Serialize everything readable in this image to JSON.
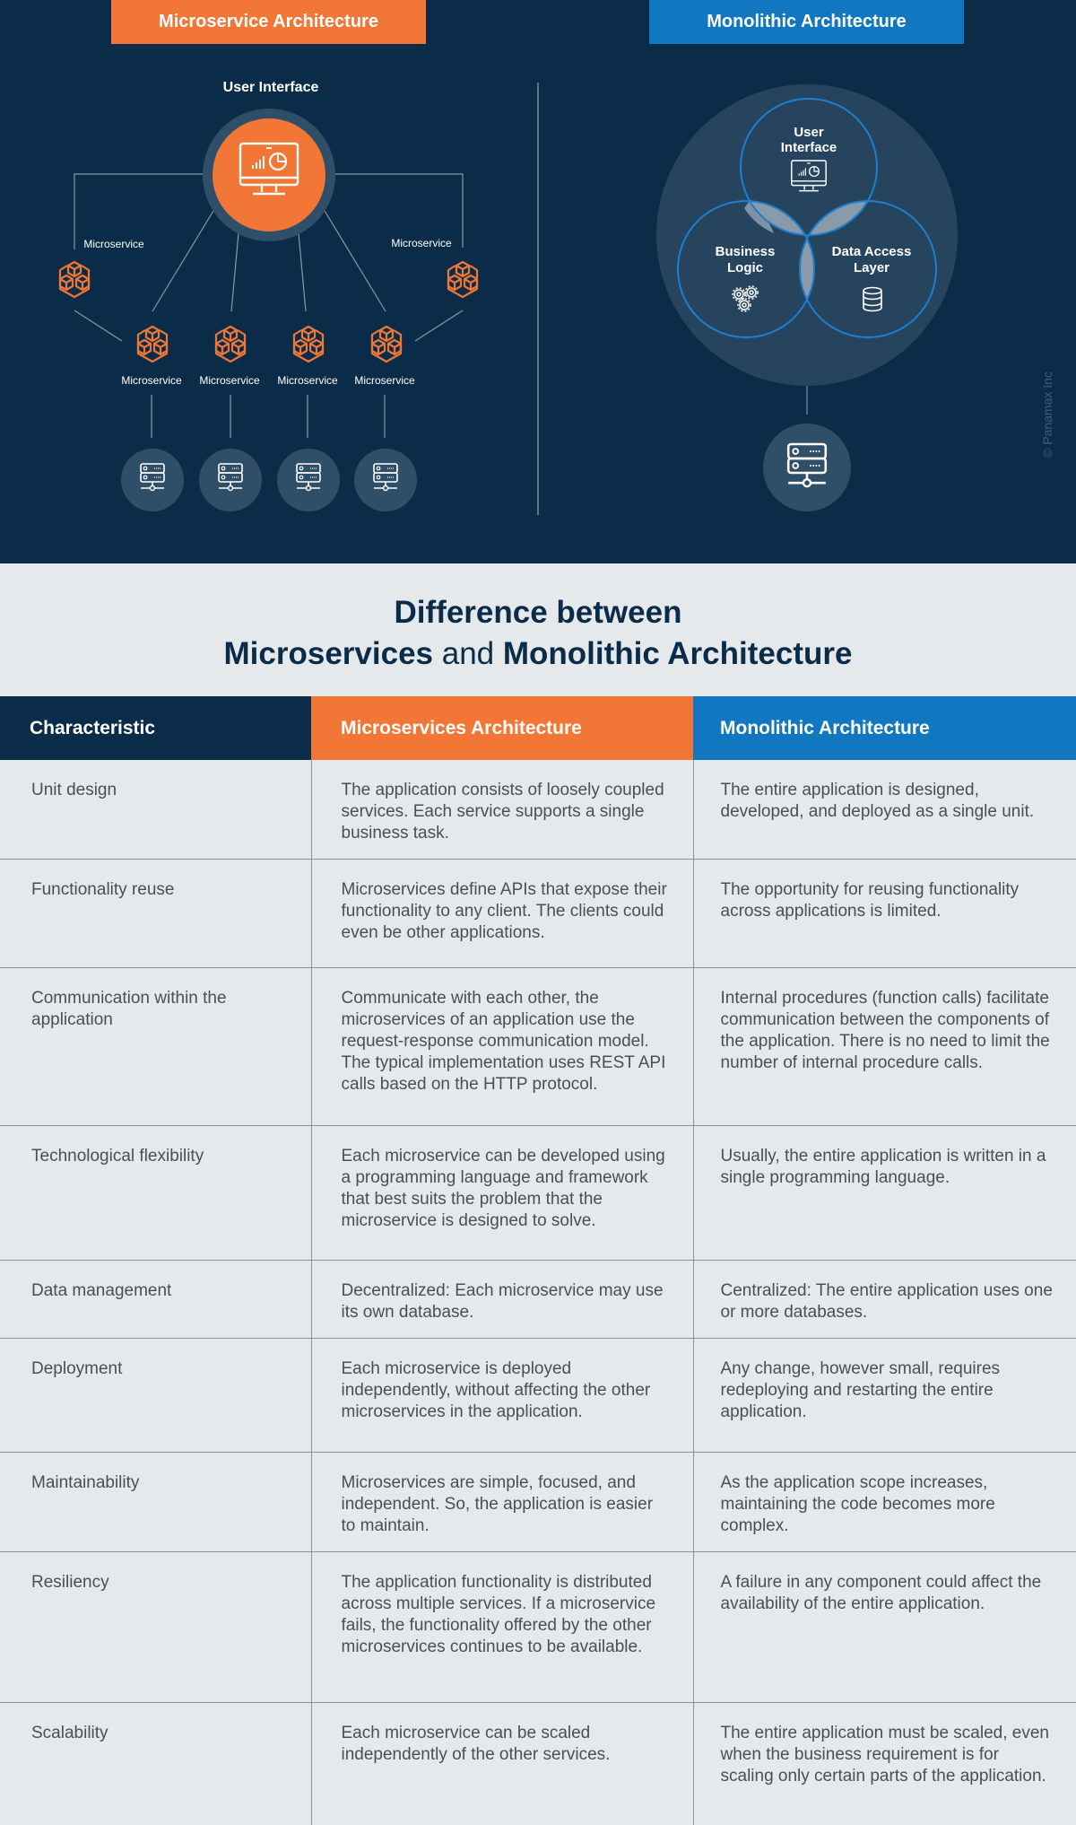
{
  "diagram": {
    "microservice_tag": "Microservice Architecture",
    "monolithic_tag": "Monolithic Architecture",
    "user_interface_label": "User Interface",
    "microservice_labels": [
      "Microservice",
      "Microservice",
      "Microservice",
      "Microservice",
      "Microservice",
      "Microservice"
    ],
    "venn": {
      "top": [
        "User",
        "Interface"
      ],
      "left": [
        "Business",
        "Logic"
      ],
      "right": [
        "Data Access",
        "Layer"
      ]
    },
    "icons": {
      "ui": "monitor-chart-icon",
      "microservice": "cubes-icon",
      "database_server": "server-icon",
      "business_logic": "gears-icon",
      "data_access": "database-icon"
    },
    "copyright": "© Panamax Inc",
    "colors": {
      "navy": "#0a2c48",
      "orange": "#f27636",
      "blue": "#1177c0",
      "light_bg": "#e6e9ec"
    }
  },
  "title": {
    "line1": "Difference between",
    "line2_a": "Microservices",
    "line2_and": " and ",
    "line2_b": "Monolithic Architecture"
  },
  "table": {
    "headers": [
      "Characteristic",
      "Microservices Architecture",
      "Monolithic Architecture"
    ],
    "rows": [
      [
        "Unit design",
        "The application consists of loosely coupled services. Each service supports a single business task.",
        "The entire application is designed, developed, and deployed as a single unit."
      ],
      [
        "Functionality reuse",
        "Microservices define APIs that expose their functionality to any client. The clients could even be other applications.",
        "The opportunity for reusing functionality across applications is limited."
      ],
      [
        "Communication within the application",
        "Communicate with each other, the microservices of an application use the request-response communication model. The typical implementation uses REST API calls based on the HTTP protocol.",
        "Internal procedures (function calls) facilitate communication between the components of the application. There is no need to limit the number of internal procedure calls."
      ],
      [
        "Technological flexibility",
        "Each microservice can be developed using a programming language and framework that best suits the problem that the microservice is designed to solve.",
        "Usually, the entire application is written in a single programming language."
      ],
      [
        "Data management",
        "Decentralized: Each microservice may use its own database.",
        "Centralized: The entire application uses one or more databases."
      ],
      [
        "Deployment",
        "Each microservice is deployed independently, without affecting the other microservices in the application.",
        "Any change, however small, requires redeploying and restarting the entire application."
      ],
      [
        "Maintainability",
        "Microservices are simple, focused, and independent. So, the application is easier to maintain.",
        "As the application scope increases, maintaining the code becomes more complex."
      ],
      [
        "Resiliency",
        "The application functionality is distributed across multiple services. If a microservice fails, the functionality offered by the other microservices continues to be available.",
        "A failure in any component could affect the availability of the entire application."
      ],
      [
        "Scalability",
        "Each microservice can be scaled independently of the other services.",
        "The entire application must be scaled, even when the business requirement is for scaling only certain parts of the application."
      ]
    ]
  }
}
